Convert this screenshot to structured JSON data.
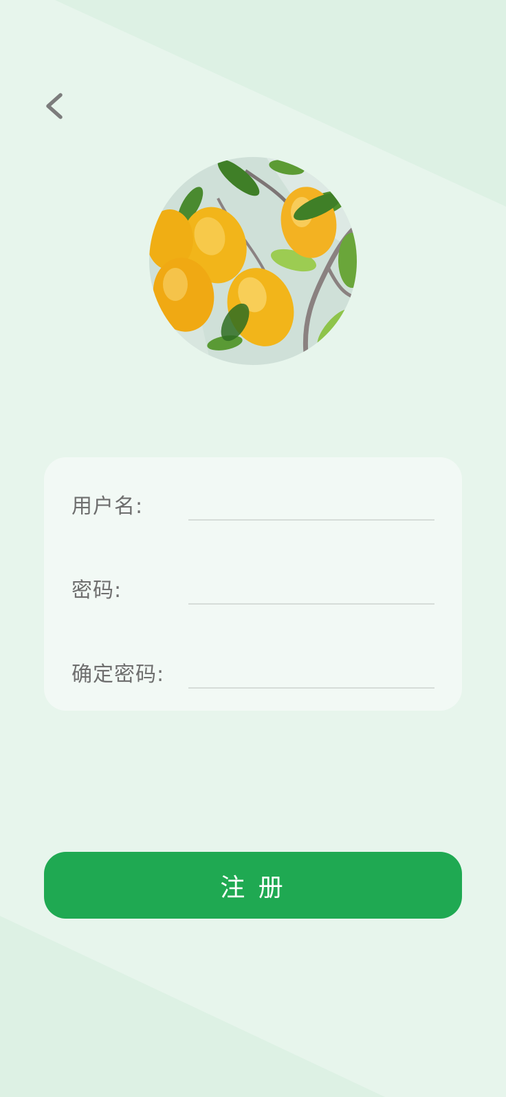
{
  "colors": {
    "background": "#e7f5ec",
    "primary_button": "#1fa952",
    "card": "#f2f9f5",
    "label_text": "#6e6e6e",
    "divider": "#d6dcd8"
  },
  "nav": {
    "back_icon": "chevron-left-icon"
  },
  "avatar": {
    "icon": "lemon-tree-painting"
  },
  "form": {
    "username": {
      "label": "用户名:",
      "value": "",
      "placeholder": ""
    },
    "password": {
      "label": "密码:",
      "value": "",
      "placeholder": ""
    },
    "confirm_password": {
      "label": "确定密码:",
      "value": "",
      "placeholder": ""
    }
  },
  "actions": {
    "register_label": "注 册"
  }
}
